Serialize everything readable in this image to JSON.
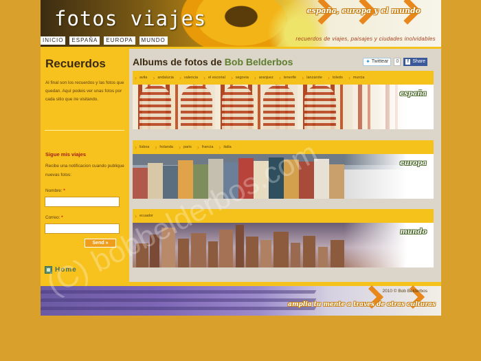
{
  "header": {
    "title": "fotos viajes",
    "tagline": "españa, europa y el mundo",
    "subtitle": "recuerdos de viajes, paisajes y ciudades inolvidables"
  },
  "nav": {
    "items": [
      {
        "label": "INICIO"
      },
      {
        "label": "ESPAÑA"
      },
      {
        "label": "EUROPA"
      },
      {
        "label": "MUNDO"
      }
    ]
  },
  "sidebar": {
    "title": "Recuerdos",
    "text": "Al final son los recuerdos y las fotos que quedan. Aquí podeis ver unas fotos por cada sitio que ire visitando.",
    "follow_title": "Sigue mis viajes",
    "follow_text": "Recibe una notificacion cuando publique nuevas fotos:",
    "name_label": "Nombre:",
    "email_label": "Correo:",
    "required_mark": "*",
    "name_value": "",
    "email_value": "",
    "send_label": "Send »",
    "home_label": "Home"
  },
  "main": {
    "heading_prefix": "Albums de fotos de",
    "heading_owner": "Bob Belderbos",
    "share": {
      "tweet_label": "Twittear",
      "tweet_count": "0",
      "fb_label": "Share"
    },
    "sections": [
      {
        "label": "españa",
        "tags": [
          "avila",
          "andalucia",
          "valencia",
          "el escorial",
          "segovia",
          "aranjuez",
          "tenerife",
          "lanzarote",
          "toledo",
          "murcia"
        ]
      },
      {
        "label": "europa",
        "tags": [
          "lisboa",
          "holanda",
          "paris",
          "francia",
          "italia"
        ]
      },
      {
        "label": "mundo",
        "tags": [
          "ecuador"
        ]
      }
    ]
  },
  "footer": {
    "copyright": "2010 © Bob Belderbos",
    "tagline": "amplia tu mente a traves de otras culturas"
  },
  "watermark": "(C) bobbelderbos.com",
  "colors": {
    "page_bg": "#d9a12c",
    "accent_yellow": "#f4c21a",
    "accent_orange": "#ef9d1d",
    "heading_green": "#5d7e2c",
    "follow_red": "#a4200c"
  }
}
